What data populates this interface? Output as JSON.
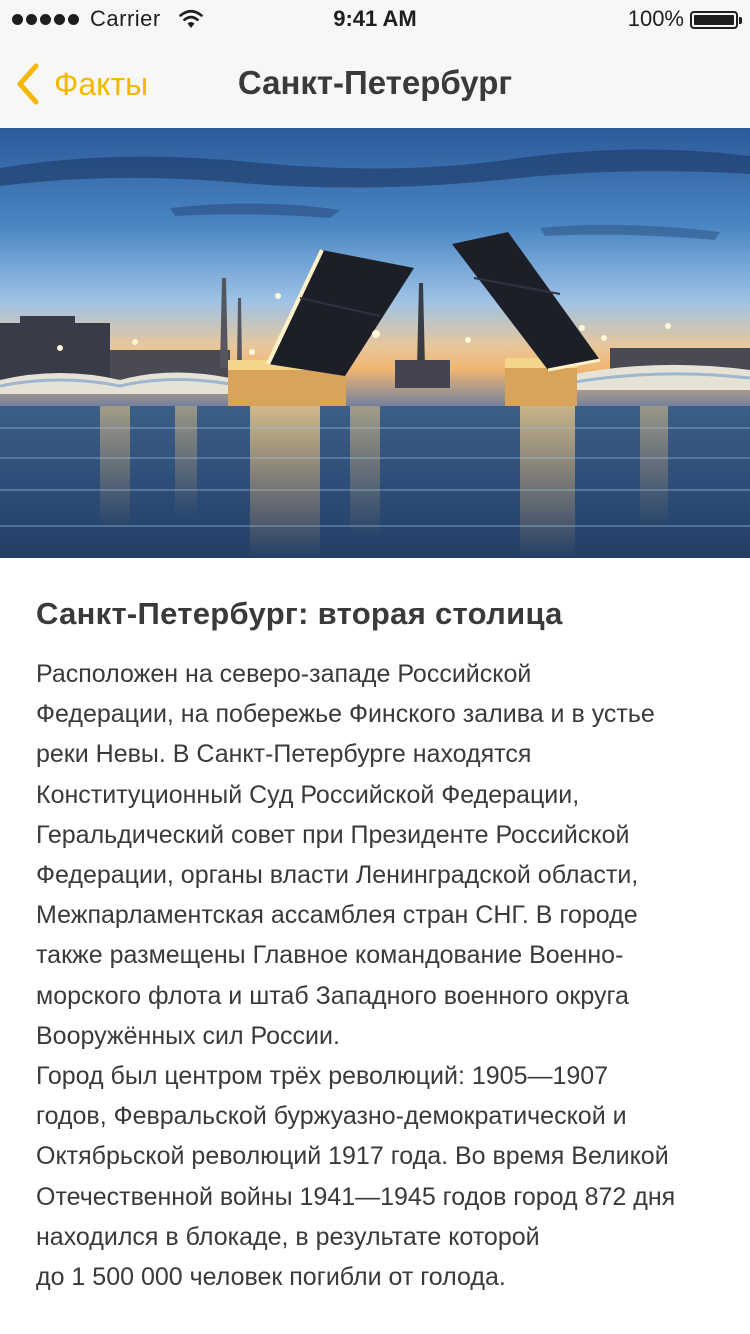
{
  "status_bar": {
    "carrier": "Carrier",
    "time": "9:41 AM",
    "battery": "100%"
  },
  "nav": {
    "back_label": "Факты",
    "title": "Санкт-Петербург"
  },
  "colors": {
    "accent": "#f5b800",
    "text": "#3a3a3a",
    "nav_background": "#f7f7f7"
  },
  "hero_image": {
    "icon": "raised-drawbridge-photo"
  },
  "article": {
    "title": "Санкт-Петербург: вторая столица",
    "lines": [
      "Расположен на северо-западе Российской",
      "Федерации, на побережье Финского залива и в устье",
      "реки Невы. В Санкт-Петербурге находятся",
      "Конституционный Суд Российской Федерации,",
      "Геральдический совет при Президенте Российской",
      "Федерации, органы власти Ленинградской области,",
      "Межпарламентская ассамблея стран СНГ. В городе",
      "также размещены Главное командование Военно-",
      "морского флота и штаб Западного военного округа",
      "Вооружённых сил России.",
      "Город был центром трёх революций: 1905—1907",
      "годов, Февральской буржуазно-демократической и",
      "Октябрьской революций 1917 года. Во время Великой",
      "Отечественной войны 1941—1945 годов город 872 дня",
      "находился в блокаде, в результате которой",
      "до 1 500 000 человек погибли от голода."
    ]
  }
}
